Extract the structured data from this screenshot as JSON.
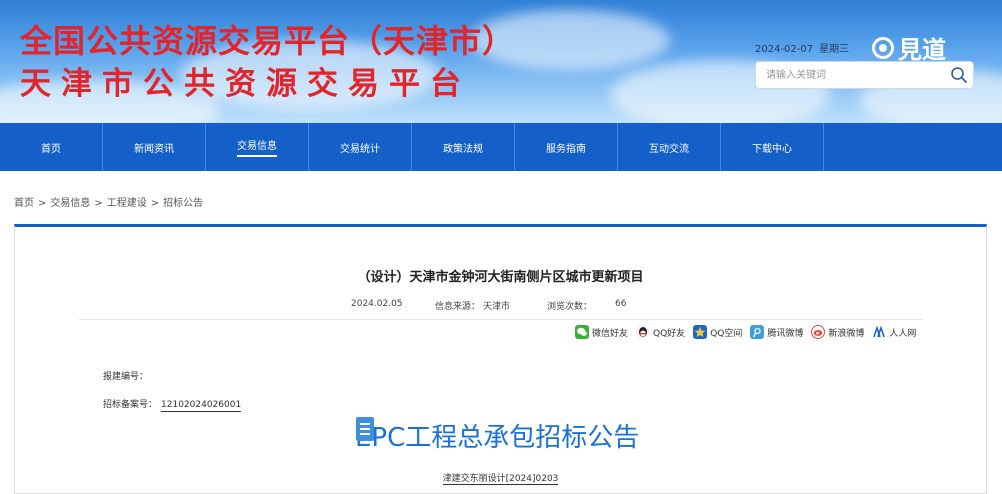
{
  "header": {
    "title_line1": "全国公共资源交易平台（天津市）",
    "title_line2": "天津市公共资源交易平台",
    "date": "2024-02-07",
    "weekday": "星期三",
    "watermark": "見道",
    "search_placeholder": "请输入关键词"
  },
  "nav": {
    "items": [
      {
        "label": "首页"
      },
      {
        "label": "新闻资讯"
      },
      {
        "label": "交易信息"
      },
      {
        "label": "交易统计"
      },
      {
        "label": "政策法规"
      },
      {
        "label": "服务指南"
      },
      {
        "label": "互动交流"
      },
      {
        "label": "下载中心"
      }
    ],
    "active_index": 2
  },
  "breadcrumb": [
    "首页",
    "交易信息",
    "工程建设",
    "招标公告"
  ],
  "breadcrumb_seps": [
    ">",
    ">",
    ">"
  ],
  "article": {
    "title": "（设计）天津市金钟河大街南侧片区城市更新项目",
    "date": "2024.02.05",
    "source_label": "信息来源：",
    "source": "天津市",
    "views_label": "浏览次数：",
    "views": "66",
    "share": [
      {
        "label": "微信好友",
        "icon": "wechat-icon"
      },
      {
        "label": "QQ好友",
        "icon": "qq-icon"
      },
      {
        "label": "QQ空间",
        "icon": "qzone-icon"
      },
      {
        "label": "腾讯微博",
        "icon": "tencent-weibo-icon"
      },
      {
        "label": "新浪微博",
        "icon": "sina-weibo-icon"
      },
      {
        "label": "人人网",
        "icon": "renren-icon"
      }
    ],
    "report_no_label": "报建编号：",
    "report_no": "",
    "bid_record_label": "招标备案号：",
    "bid_record": "12102024026001",
    "big_title": "EPC工程总承包招标公告",
    "doc_code": "津建交东丽设计[2024]0203"
  },
  "colors": {
    "brand_red": "#e2242b",
    "nav_blue": "#1560c8",
    "title_blue": "#1a72d6"
  }
}
